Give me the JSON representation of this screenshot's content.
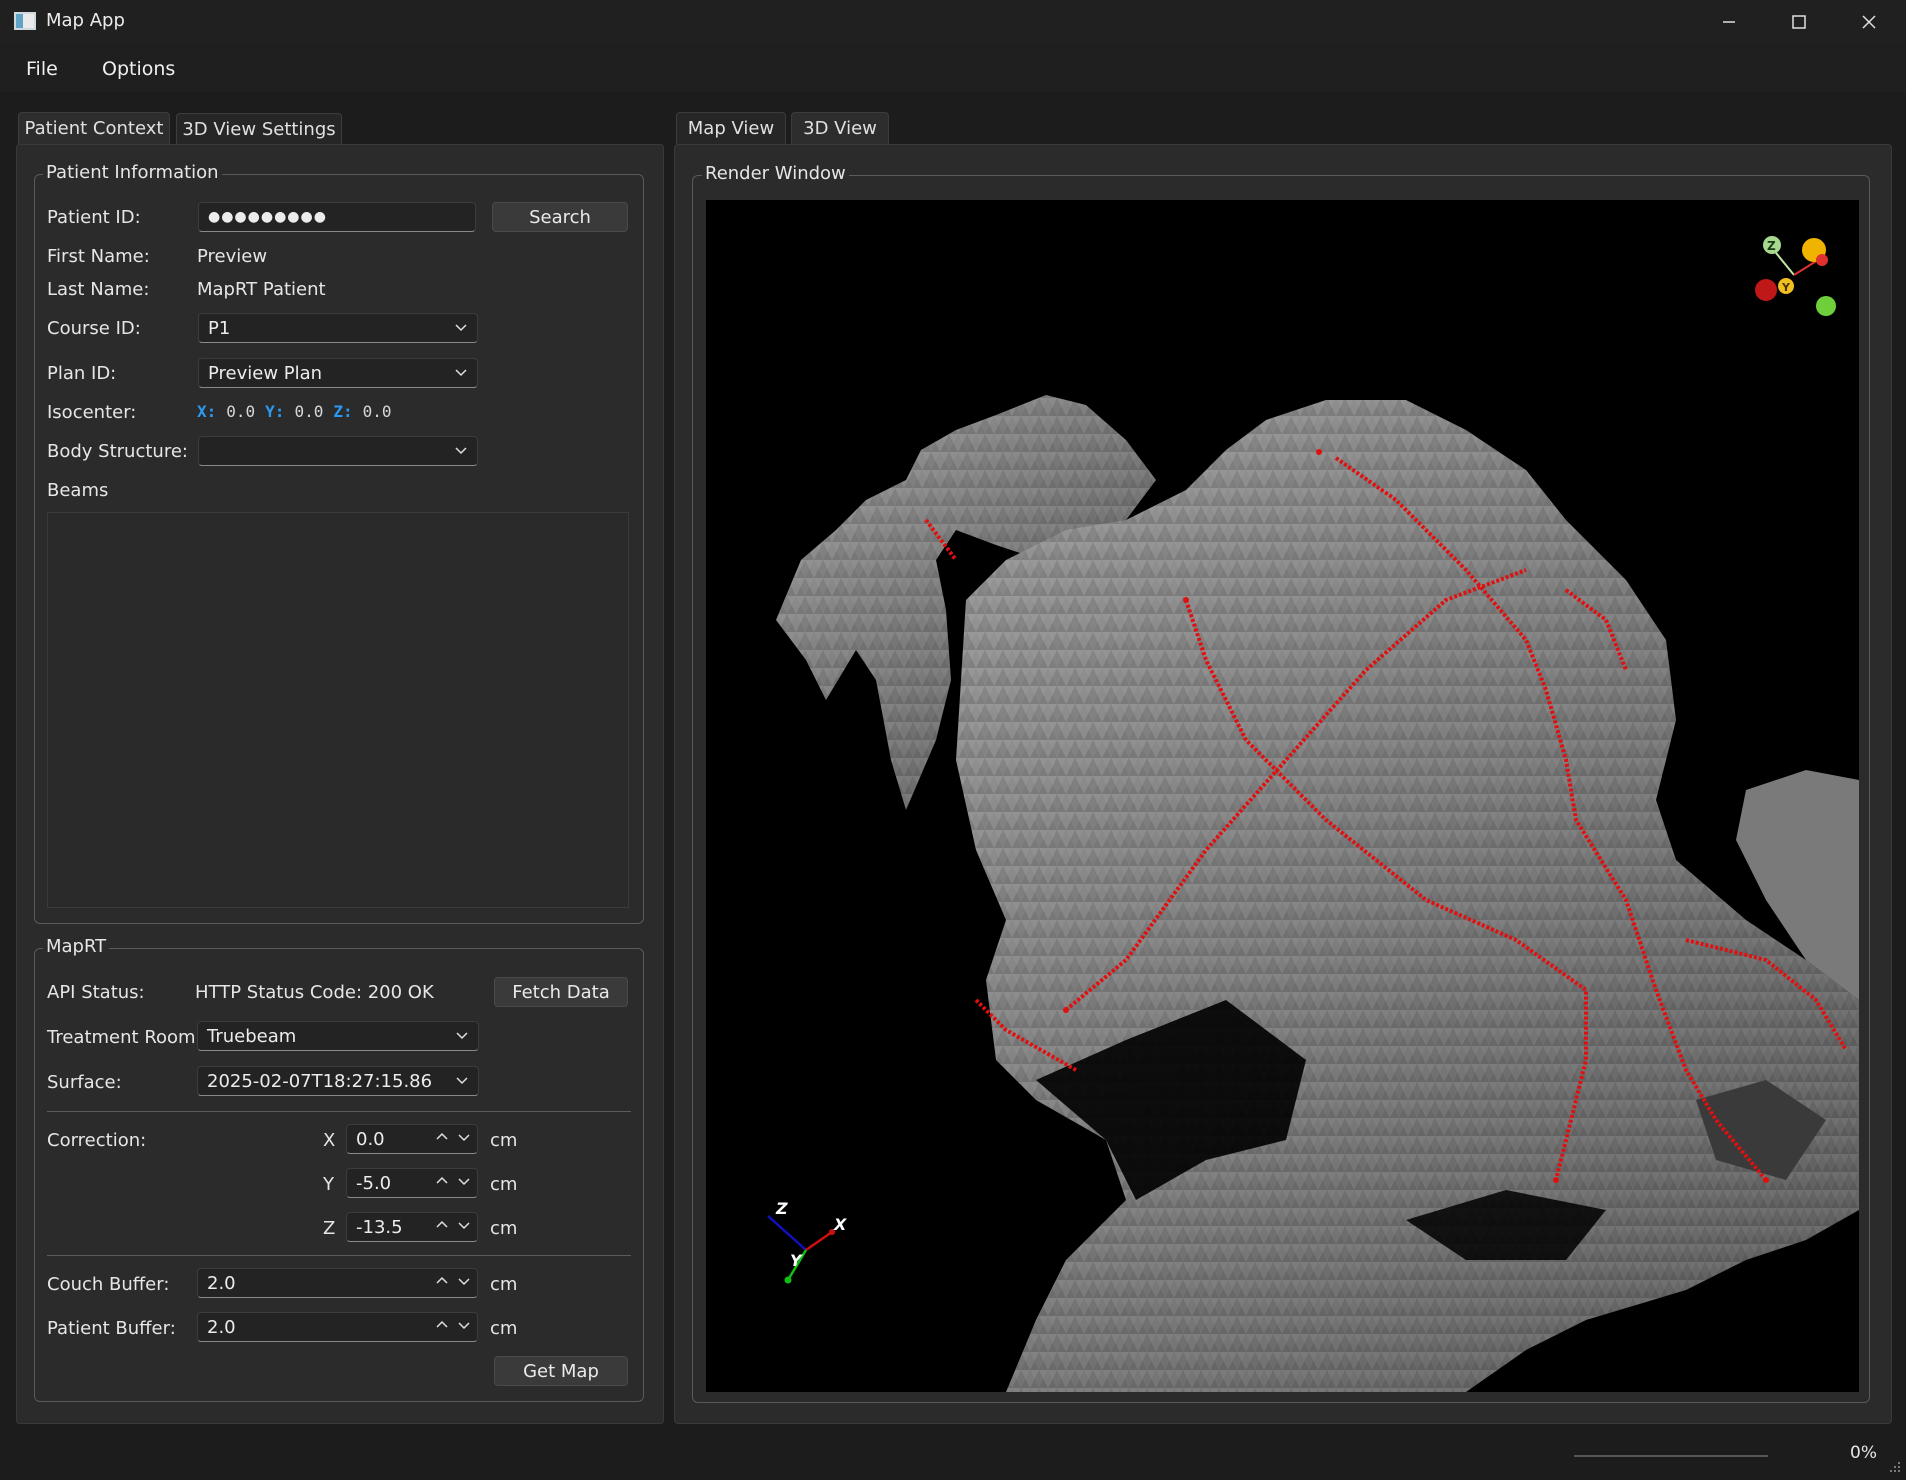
{
  "window": {
    "title": "Map App"
  },
  "menu": {
    "file": "File",
    "options": "Options"
  },
  "left_tabs": [
    "Patient Context",
    "3D View Settings"
  ],
  "right_tabs": [
    "Map View",
    "3D View"
  ],
  "patient_info": {
    "group_title": "Patient Information",
    "patient_id_label": "Patient ID:",
    "patient_id_value": "●●●●●●●●●",
    "search_button": "Search",
    "first_name_label": "First Name:",
    "first_name_value": "Preview",
    "last_name_label": "Last Name:",
    "last_name_value": "MapRT Patient",
    "course_id_label": "Course ID:",
    "course_id_value": "P1",
    "plan_id_label": "Plan ID:",
    "plan_id_value": "Preview Plan",
    "isocenter_label": "Isocenter:",
    "iso_x_label": "X:",
    "iso_x_value": "0.0",
    "iso_y_label": "Y:",
    "iso_y_value": "0.0",
    "iso_z_label": "Z:",
    "iso_z_value": "0.0",
    "body_structure_label": "Body Structure:",
    "body_structure_value": "",
    "beams_label": "Beams"
  },
  "maprt": {
    "group_title": "MapRT",
    "api_status_label": "API Status:",
    "api_status_value": "HTTP Status Code: 200 OK",
    "fetch_button": "Fetch Data",
    "treatment_room_label": "Treatment Room:",
    "treatment_room_value": "Truebeam",
    "surface_label": "Surface:",
    "surface_value": "2025-02-07T18:27:15.86",
    "correction_label": "Correction:",
    "corr_x_label": "X",
    "corr_x_value": "0.0",
    "corr_y_label": "Y",
    "corr_y_value": "-5.0",
    "corr_z_label": "Z",
    "corr_z_value": "-13.5",
    "unit": "cm",
    "couch_buffer_label": "Couch Buffer:",
    "couch_buffer_value": "2.0",
    "patient_buffer_label": "Patient Buffer:",
    "patient_buffer_value": "2.0",
    "get_map_button": "Get Map"
  },
  "render": {
    "group_title": "Render Window",
    "axes_labels": {
      "x": "X",
      "y": "Y",
      "z": "Z"
    },
    "orient_labels": {
      "z": "Z",
      "y": "Y"
    }
  },
  "status": {
    "progress_text": "0%",
    "progress": 0
  },
  "colors": {
    "accent_blue": "#2b9af3",
    "path_red": "#e01010",
    "mesh_gray": "#8a8a8a"
  }
}
